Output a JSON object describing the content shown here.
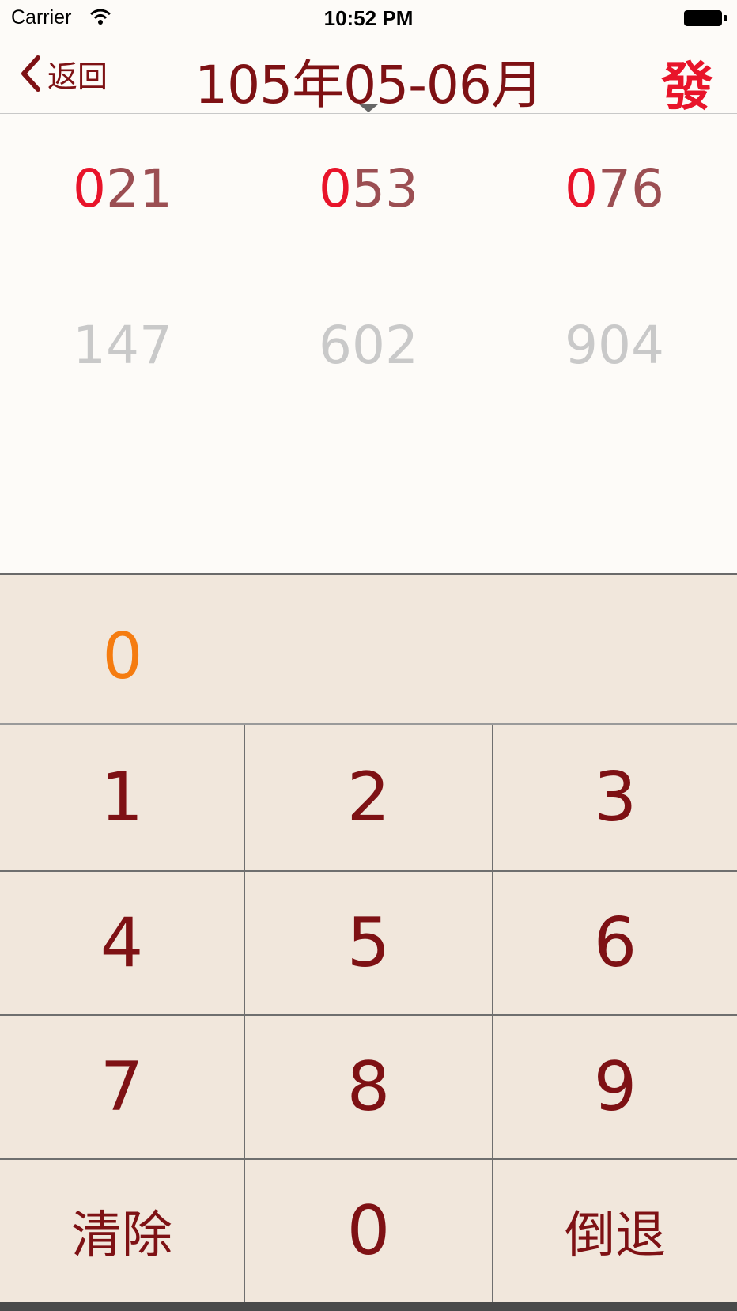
{
  "status_bar": {
    "carrier": "Carrier",
    "time": "10:52 PM",
    "icons": [
      "wifi-icon",
      "battery-icon"
    ]
  },
  "nav": {
    "back_label": "返回",
    "title": "105年05-06月",
    "right_label": "發",
    "back_icon": "chevron-left-icon",
    "caret_icon": "caret-down-icon"
  },
  "numbers": {
    "row1": [
      {
        "prefix": "0",
        "rest": "21"
      },
      {
        "prefix": "0",
        "rest": "53"
      },
      {
        "prefix": "0",
        "rest": "76"
      }
    ],
    "row2": [
      "147",
      "602",
      "904"
    ]
  },
  "display": {
    "value": "0"
  },
  "keypad": {
    "k1": "1",
    "k2": "2",
    "k3": "3",
    "k4": "4",
    "k5": "5",
    "k6": "6",
    "k7": "7",
    "k8": "8",
    "k9": "9",
    "clear": "清除",
    "k0": "0",
    "backspace": "倒退"
  },
  "colors": {
    "primary": "#7e1114",
    "accent_red": "#e8142a",
    "display_orange": "#f57c10",
    "keypad_bg": "#f1e7dc",
    "page_bg": "#fdfbf8",
    "muted": "#c9c9c9"
  }
}
